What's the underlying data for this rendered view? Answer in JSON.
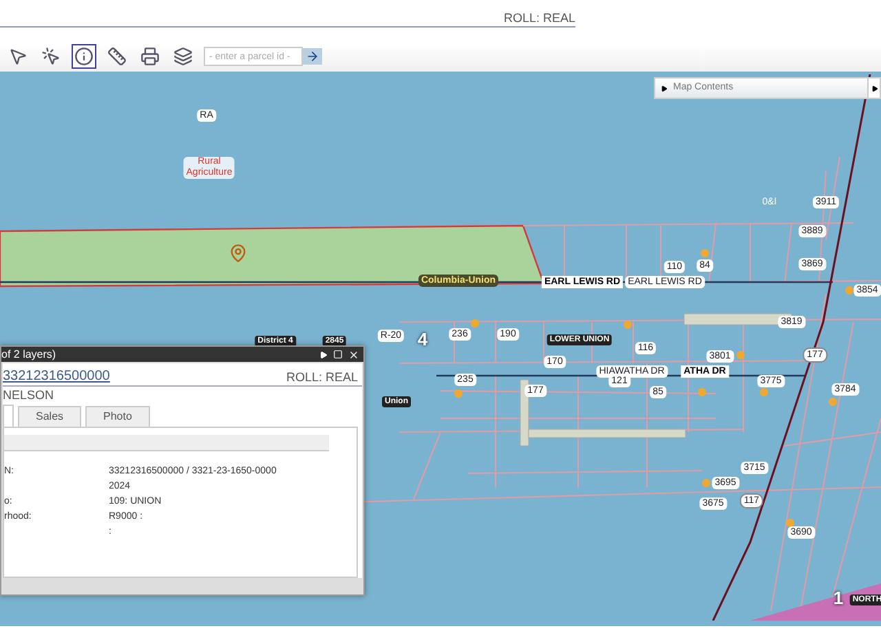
{
  "header": {
    "roll": "ROLL: REAL"
  },
  "toolbar": {
    "tools": [
      {
        "kind": "pointer",
        "selected": false
      },
      {
        "kind": "pointer-plus",
        "selected": false
      },
      {
        "kind": "info",
        "selected": true
      },
      {
        "kind": "measure",
        "selected": false
      },
      {
        "kind": "print",
        "selected": false
      },
      {
        "kind": "layers",
        "selected": false
      }
    ],
    "search": {
      "placeholder": "- enter a parcel id -"
    }
  },
  "map_contents": {
    "label": "Map Contents"
  },
  "map": {
    "labels": [
      {
        "text": "RA",
        "kind": "halo"
      },
      {
        "text": "Rural\nAgriculture",
        "kind": "zone"
      },
      {
        "text": "0&I",
        "kind": "plain"
      },
      {
        "text": "3911",
        "kind": "halo"
      },
      {
        "text": "3889",
        "kind": "halo"
      },
      {
        "text": "110",
        "kind": "halo"
      },
      {
        "text": "84",
        "kind": "halo"
      },
      {
        "text": "3869",
        "kind": "halo"
      },
      {
        "text": "3854",
        "kind": "halo"
      },
      {
        "text": "Columbia-Union",
        "kind": "district"
      },
      {
        "text": "EARL LEWIS RD",
        "kind": "road"
      },
      {
        "text": "EARL LEWIS RD",
        "kind": "halo"
      },
      {
        "text": "3819",
        "kind": "halo"
      },
      {
        "text": "District 4",
        "kind": "dark"
      },
      {
        "text": "2845",
        "kind": "dark"
      },
      {
        "text": "R-20",
        "kind": "halo"
      },
      {
        "text": "4",
        "kind": "big"
      },
      {
        "text": "236",
        "kind": "halo"
      },
      {
        "text": "190",
        "kind": "halo"
      },
      {
        "text": "LOWER UNION",
        "kind": "dark"
      },
      {
        "text": "116",
        "kind": "halo"
      },
      {
        "text": "3801",
        "kind": "halo"
      },
      {
        "text": "177",
        "kind": "shield"
      },
      {
        "text": "170",
        "kind": "halo"
      },
      {
        "text": "HIAWATHA DR",
        "kind": "halo"
      },
      {
        "text": "ATHA DR",
        "kind": "road"
      },
      {
        "text": "235",
        "kind": "halo"
      },
      {
        "text": "121",
        "kind": "halo"
      },
      {
        "text": "3775",
        "kind": "halo"
      },
      {
        "text": "177",
        "kind": "halo"
      },
      {
        "text": "85",
        "kind": "halo"
      },
      {
        "text": "3784",
        "kind": "halo"
      },
      {
        "text": "Union",
        "kind": "dark"
      },
      {
        "text": "3715",
        "kind": "halo"
      },
      {
        "text": "3695",
        "kind": "halo"
      },
      {
        "text": "3675",
        "kind": "halo"
      },
      {
        "text": "117",
        "kind": "shield"
      },
      {
        "text": "3690",
        "kind": "halo"
      },
      {
        "text": "1",
        "kind": "big"
      },
      {
        "text": "NORTH",
        "kind": "dark"
      }
    ]
  },
  "popup": {
    "title": "of 2 layers)",
    "parcel_link": "33212316500000",
    "roll": "ROLL: REAL",
    "owner": "NELSON",
    "tabs": [
      {
        "selected": true
      },
      {
        "label": "Sales",
        "selected": false
      },
      {
        "label": "Photo",
        "selected": false
      }
    ],
    "rows": [
      {
        "label": "N:",
        "value": "33212316500000 / 3321-23-1650-0000"
      },
      {
        "value": "2024"
      },
      {
        "label": "o:",
        "value": "109: UNION"
      },
      {
        "label": "rhood:",
        "value": "R9000 :"
      },
      {
        "value": ":"
      }
    ]
  }
}
